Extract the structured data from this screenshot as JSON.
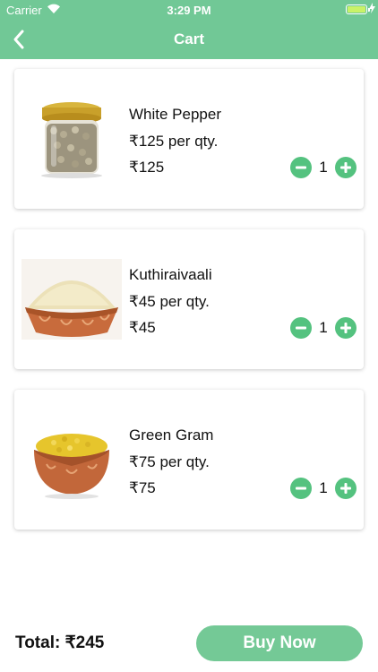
{
  "status_bar": {
    "carrier": "Carrier",
    "time": "3:29 PM"
  },
  "navbar": {
    "title": "Cart"
  },
  "cart": {
    "items": [
      {
        "name": "White Pepper",
        "unit_price": "₹125 per qty.",
        "price": "₹125",
        "quantity": "1"
      },
      {
        "name": "Kuthiraivaali",
        "unit_price": "₹45 per qty.",
        "price": "₹45",
        "quantity": "1"
      },
      {
        "name": "Green Gram",
        "unit_price": "₹75 per qty.",
        "price": "₹75",
        "quantity": "1"
      }
    ]
  },
  "footer": {
    "total": "Total: ₹245",
    "buy_label": "Buy Now"
  },
  "colors": {
    "brand_green": "#71c896",
    "button_green": "#54c27f"
  }
}
